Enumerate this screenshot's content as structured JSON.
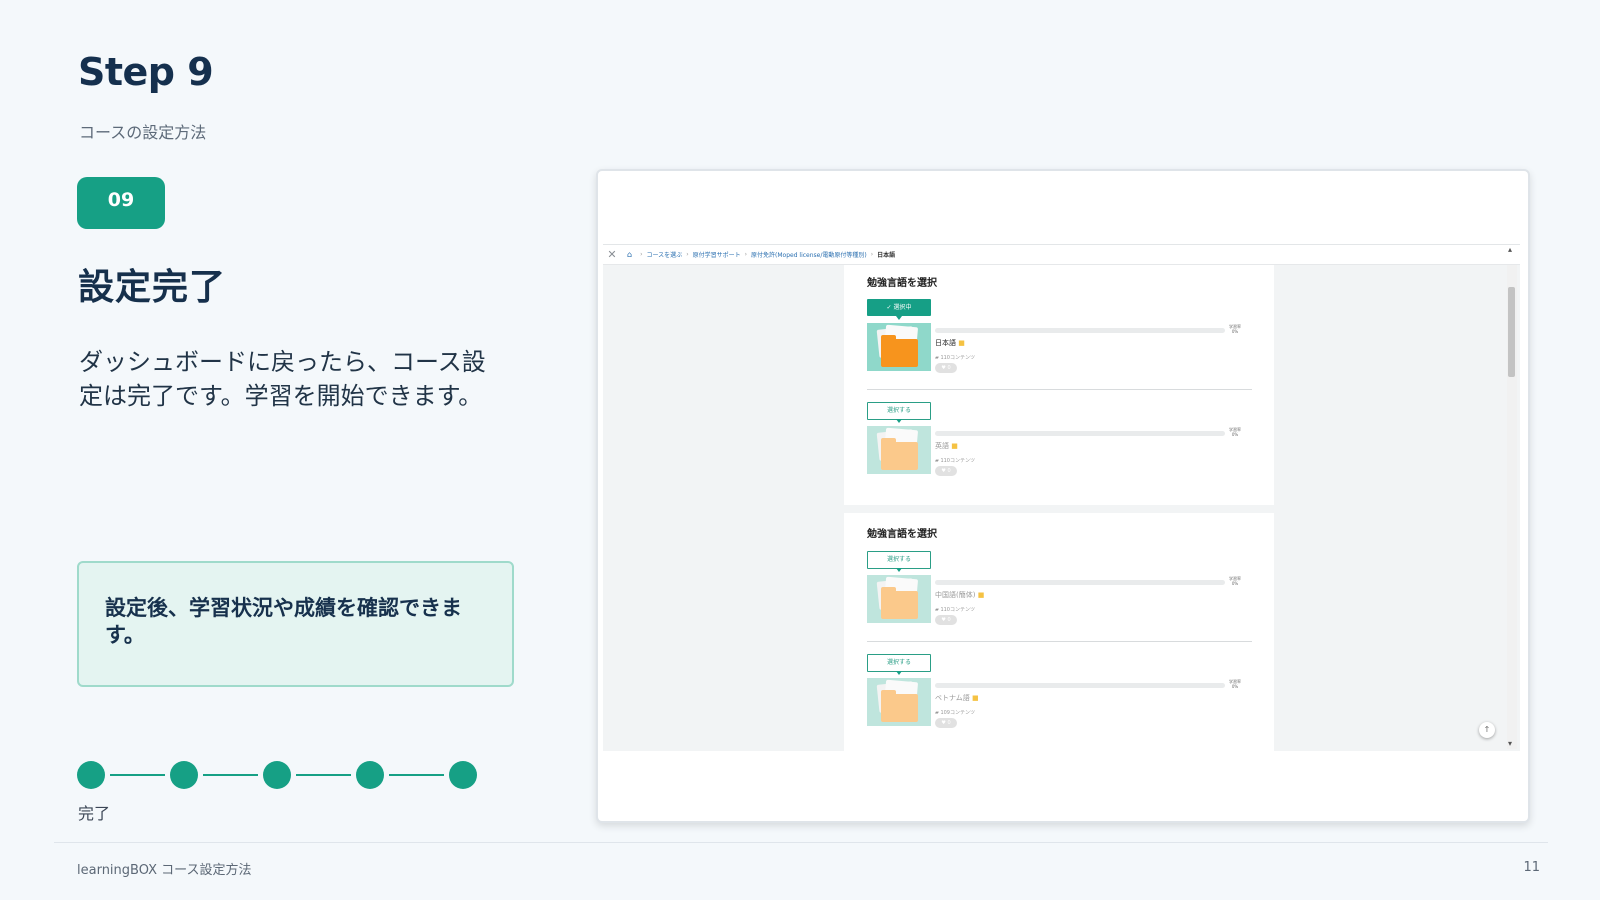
{
  "slide": {
    "title": "Step 9",
    "subtitle": "コースの設定方法",
    "badge": "09",
    "heading": "設定完了",
    "description": "ダッシュボードに戻ったら、コース設定は完了です。学習を開始できます。",
    "callout": "設定後、学習状況や成績を確認できます。",
    "progress": {
      "steps": 5,
      "completed": 5,
      "label": "完了"
    },
    "footer": {
      "left": "learningBOX コース設定方法",
      "page": "11"
    },
    "accent_color": "#16a085"
  },
  "screenshot": {
    "breadcrumb": {
      "close_icon": "close-icon",
      "home_icon": "home-icon",
      "items": [
        "コースを選ぶ",
        "原付学習サポート",
        "原付免許(Moped license/電動原付等種別)"
      ],
      "current": "日本語"
    },
    "sections": [
      {
        "title": "勉強言語を選択",
        "items": [
          {
            "button": "✓ 選択中",
            "selected": true,
            "name": "日本語",
            "count": "110コンテンツ",
            "progress_label": "学習率",
            "progress_value": "0%",
            "likes": "0"
          },
          {
            "button": "選択する",
            "selected": false,
            "name": "英語",
            "count": "110コンテンツ",
            "progress_label": "学習率",
            "progress_value": "0%",
            "likes": "0"
          }
        ]
      },
      {
        "title": "勉強言語を選択",
        "items": [
          {
            "button": "選択する",
            "selected": false,
            "name": "中国語(簡体)",
            "count": "110コンテンツ",
            "progress_label": "学習率",
            "progress_value": "0%",
            "likes": "0"
          },
          {
            "button": "選択する",
            "selected": false,
            "name": "ベトナム語",
            "count": "109コンテンツ",
            "progress_label": "学習率",
            "progress_value": "0%",
            "likes": "0"
          }
        ]
      }
    ],
    "to_top_icon": "arrow-up-icon"
  }
}
